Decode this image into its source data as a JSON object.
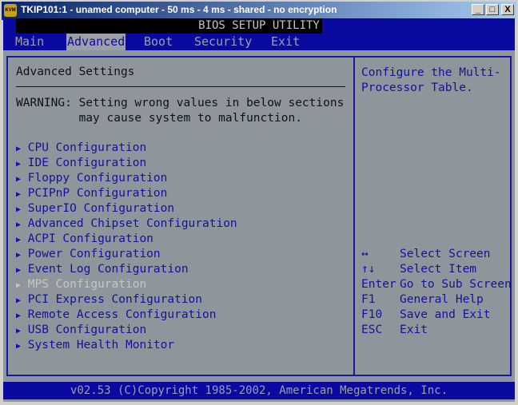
{
  "window": {
    "title": "TKIP101:1 - unamed computer - 50 ms - 4 ms - shared - no encryption",
    "icon": "kvm-icon",
    "buttons": [
      "_",
      "□",
      "X"
    ]
  },
  "bios": {
    "title": "BIOS SETUP UTILITY",
    "tabs": [
      "Main",
      "Advanced",
      "Boot",
      "Security",
      "Exit"
    ],
    "active_tab": "Advanced",
    "section_title": "Advanced Settings",
    "warning_line1": "WARNING: Setting wrong values in below sections",
    "warning_line2": "         may cause system to malfunction.",
    "items": [
      {
        "label": "CPU Configuration"
      },
      {
        "label": "IDE Configuration"
      },
      {
        "label": "Floppy Configuration"
      },
      {
        "label": "PCIPnP Configuration"
      },
      {
        "label": "SuperIO Configuration"
      },
      {
        "label": "Advanced Chipset Configuration"
      },
      {
        "label": "ACPI Configuration"
      },
      {
        "label": "Power Configuration"
      },
      {
        "label": "Event Log Configuration"
      },
      {
        "label": "MPS Configuration",
        "selected": true
      },
      {
        "label": "PCI Express Configuration"
      },
      {
        "label": "Remote Access Configuration"
      },
      {
        "label": "USB Configuration"
      },
      {
        "label": "System Health Monitor"
      }
    ],
    "help_line1": "Configure the Multi-",
    "help_line2": "Processor Table.",
    "keys": [
      {
        "key": "↔",
        "action": "Select Screen"
      },
      {
        "key": "↑↓",
        "action": "Select Item"
      },
      {
        "key": "Enter",
        "action": "Go to Sub Screen"
      },
      {
        "key": "F1",
        "action": "General Help"
      },
      {
        "key": "F10",
        "action": "Save and Exit"
      },
      {
        "key": "ESC",
        "action": "Exit"
      }
    ],
    "footer": "v02.53 (C)Copyright 1985-2002, American Megatrends, Inc.",
    "colors": {
      "background": "#8e969c",
      "bar": "#0a0aa0",
      "text": "#12129c",
      "selected": "#c6c6c6"
    }
  }
}
